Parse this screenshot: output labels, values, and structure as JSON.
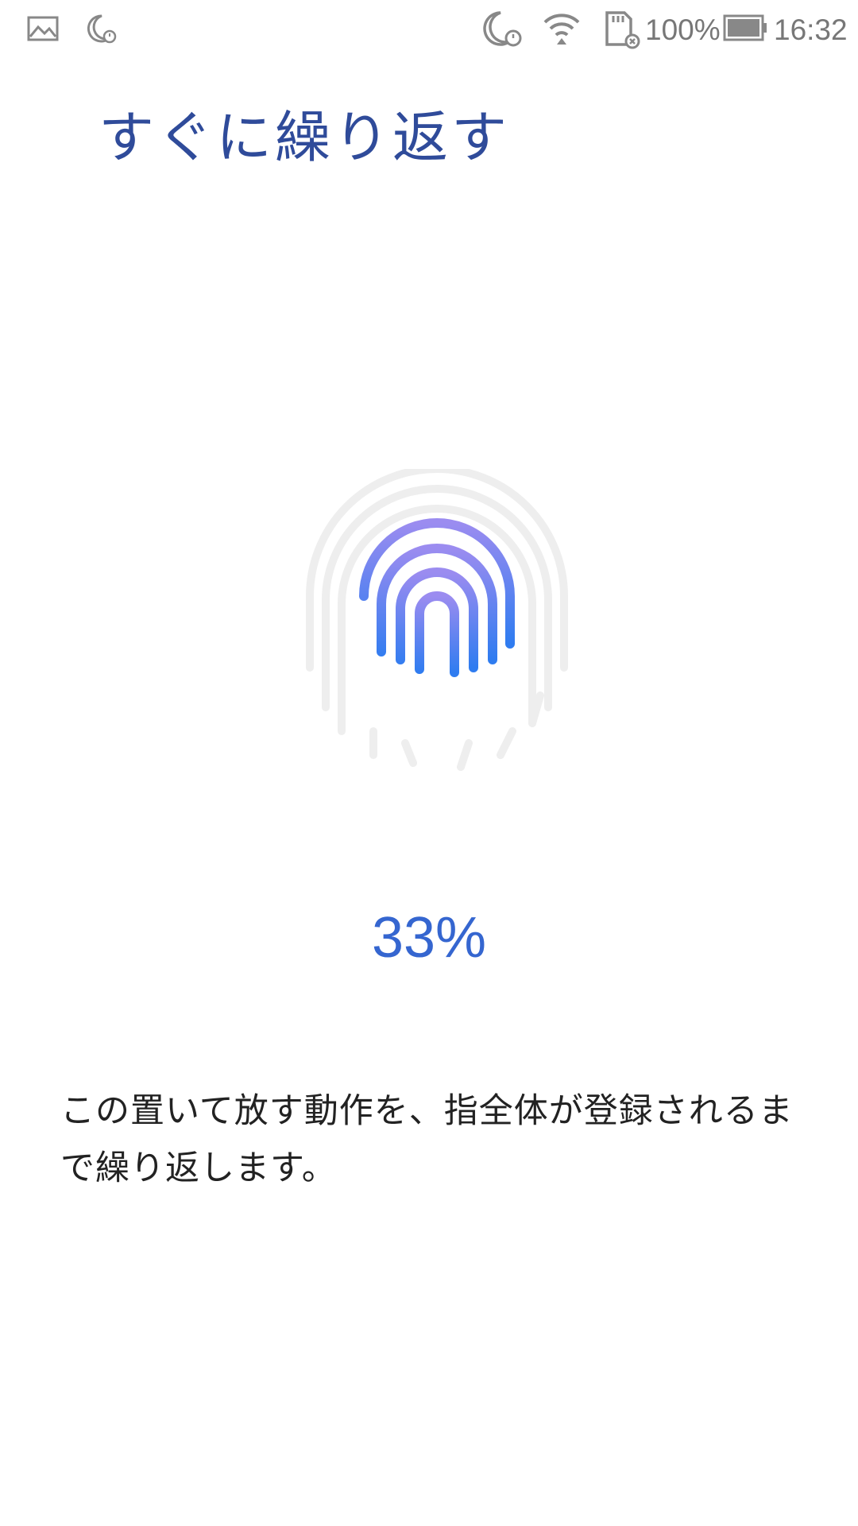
{
  "status_bar": {
    "icons": [
      "image-icon",
      "moon-alarm-icon",
      "moon-alarm-icon",
      "wifi-icon",
      "sd-card-icon",
      "battery-icon"
    ],
    "battery": "100%",
    "time": "16:32"
  },
  "page": {
    "title": "すぐに繰り返す"
  },
  "progress": {
    "label": "33%",
    "value": 0.33
  },
  "instruction": {
    "text": "この置いて放す動作を、指全体が登録されるまで繰り返します。"
  },
  "colors": {
    "title": "#2f4b9a",
    "progress": "#3566d0",
    "fingerprint_start": "#9b8cf0",
    "fingerprint_end": "#2f7cf0",
    "fingerprint_bg": "#eeeeee"
  }
}
